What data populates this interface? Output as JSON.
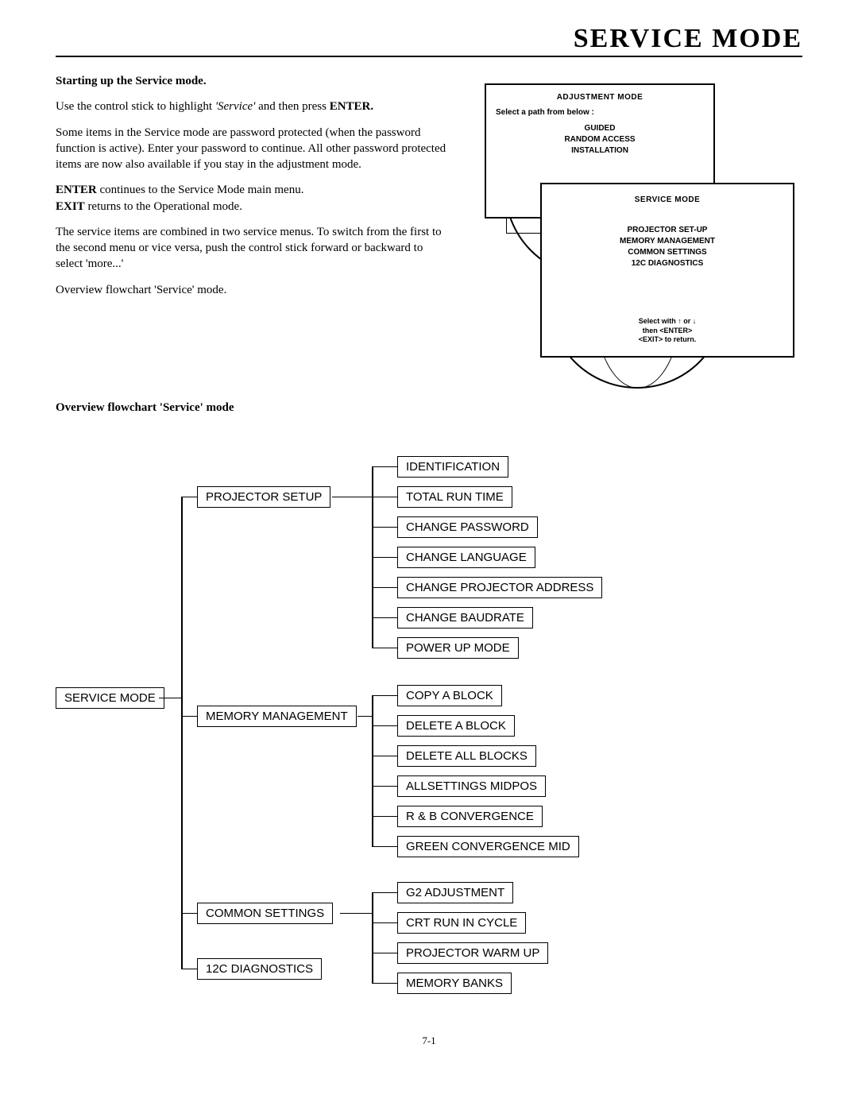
{
  "title": "SERVICE MODE",
  "page_number": "7-1",
  "section1_heading": "Starting up the Service mode.",
  "para1_a": "Use the control stick to highlight ",
  "para1_i": "'Service'",
  "para1_b": " and then press ",
  "para1_bold": "ENTER.",
  "para2": "Some items in the Service mode are password protected (when the password function is active). Enter your password to continue. All other password protected items are now also available if you stay in the adjustment mode.",
  "para3_bold1": "ENTER",
  "para3_rest1": " continues to the Service Mode main menu.",
  "para3_bold2": "EXIT",
  "para3_rest2": " returns to the Operational mode.",
  "para4": "The service items are combined in two service menus. To switch from the first to the second menu or vice versa, push the control stick forward or backward to select 'more...'",
  "para5": "Overview flowchart 'Service' mode.",
  "flow_heading": "Overview flowchart 'Service' mode",
  "screenA": {
    "title": "ADJUSTMENT MODE",
    "hint": "Select a path from below :",
    "items": [
      "GUIDED",
      "RANDOM ACCESS",
      "INSTALLATION"
    ]
  },
  "screenB": {
    "title": "SERVICE MODE",
    "items": [
      "PROJECTOR SET-UP",
      "MEMORY MANAGEMENT",
      "COMMON SETTINGS",
      "12C DIAGNOSTICS"
    ],
    "hint1": "Select with ↑ or ↓",
    "hint2": "then  <ENTER>",
    "hint3": "<EXIT>  to return."
  },
  "flow": {
    "root": "SERVICE MODE",
    "branches": [
      {
        "label": "PROJECTOR SETUP",
        "children": [
          "IDENTIFICATION",
          "TOTAL RUN TIME",
          "CHANGE PASSWORD",
          "CHANGE LANGUAGE",
          "CHANGE PROJECTOR ADDRESS",
          "CHANGE BAUDRATE",
          "POWER UP MODE"
        ]
      },
      {
        "label": "MEMORY MANAGEMENT",
        "children": [
          "COPY A BLOCK",
          "DELETE A BLOCK",
          "DELETE ALL BLOCKS",
          "ALLSETTINGS MIDPOS",
          "R & B CONVERGENCE",
          "GREEN CONVERGENCE MID"
        ]
      },
      {
        "label": "COMMON SETTINGS",
        "children": [
          "G2 ADJUSTMENT",
          "CRT RUN IN CYCLE",
          "PROJECTOR WARM UP",
          "MEMORY BANKS"
        ]
      },
      {
        "label": "12C DIAGNOSTICS",
        "children": []
      }
    ]
  }
}
